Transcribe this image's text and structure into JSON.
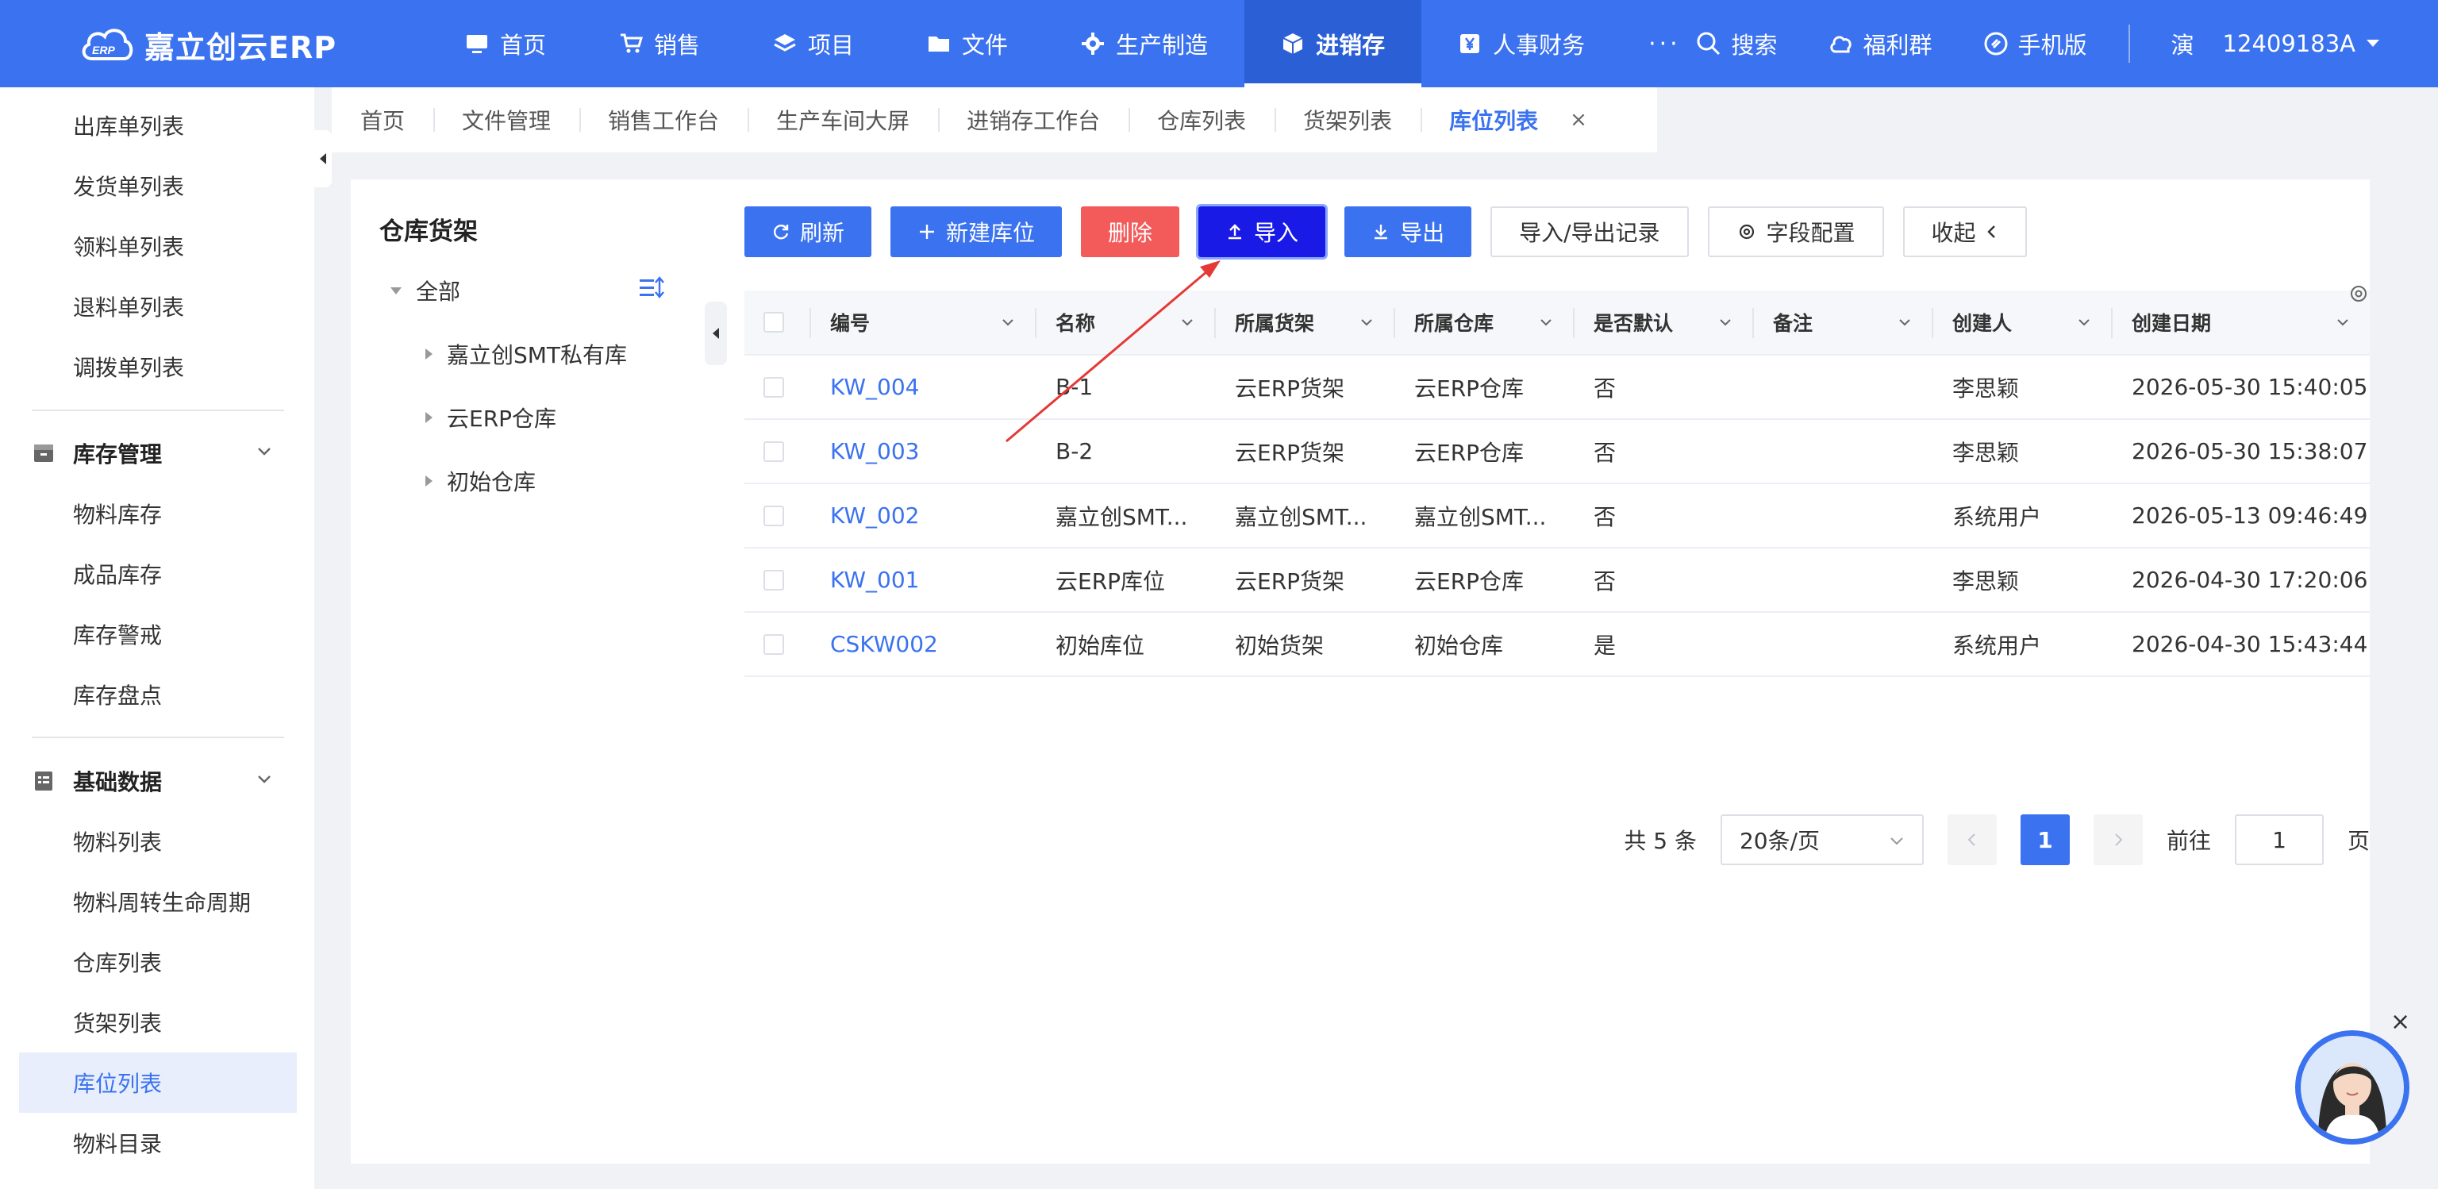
{
  "app": {
    "logo_text": "嘉立创云ERP",
    "logo_badge": "ERP",
    "accent_color": "#3a72f0"
  },
  "nav": {
    "items": [
      {
        "label": "首页",
        "icon": "monitor-icon"
      },
      {
        "label": "销售",
        "icon": "cart-icon"
      },
      {
        "label": "项目",
        "icon": "layers-icon"
      },
      {
        "label": "文件",
        "icon": "folder-icon"
      },
      {
        "label": "生产制造",
        "icon": "gear-icon"
      },
      {
        "label": "进销存",
        "icon": "box-icon",
        "active": true
      },
      {
        "label": "人事财务",
        "icon": "yen-icon"
      }
    ],
    "more": "···"
  },
  "top_right": {
    "search": "搜索",
    "welfare": "福利群",
    "mobile": "手机版",
    "user_initial": "演",
    "user_id": "12409183A"
  },
  "sidebar": {
    "items_top": [
      "出库单列表",
      "发货单列表",
      "领料单列表",
      "退料单列表",
      "调拨单列表"
    ],
    "group_inventory": {
      "label": "库存管理",
      "items": [
        "物料库存",
        "成品库存",
        "库存警戒",
        "库存盘点"
      ]
    },
    "group_basic": {
      "label": "基础数据",
      "items": [
        "物料列表",
        "物料周转生命周期",
        "仓库列表",
        "货架列表",
        "库位列表",
        "物料目录"
      ]
    },
    "active_item": "库位列表"
  },
  "tabs": {
    "items": [
      "首页",
      "文件管理",
      "销售工作台",
      "生产车间大屏",
      "进销存工作台",
      "仓库列表",
      "货架列表",
      "库位列表"
    ],
    "active": "库位列表",
    "close": "×"
  },
  "tree": {
    "title": "仓库货架",
    "root": "全部",
    "nodes": [
      "嘉立创SMT私有库",
      "云ERP仓库",
      "初始仓库"
    ]
  },
  "toolbar": {
    "refresh": "刷新",
    "new": "新建库位",
    "delete": "删除",
    "import": "导入",
    "export": "导出",
    "records": "导入/导出记录",
    "fields": "字段配置",
    "collapse": "收起"
  },
  "table": {
    "columns": [
      "编号",
      "名称",
      "所属货架",
      "所属仓库",
      "是否默认",
      "备注",
      "创建人",
      "创建日期"
    ],
    "rows": [
      {
        "code": "KW_004",
        "name": "B-1",
        "shelf": "云ERP货架",
        "warehouse": "云ERP仓库",
        "default": "否",
        "note": "",
        "creator": "李思颖",
        "date": "2026-05-30 15:40:05"
      },
      {
        "code": "KW_003",
        "name": "B-2",
        "shelf": "云ERP货架",
        "warehouse": "云ERP仓库",
        "default": "否",
        "note": "",
        "creator": "李思颖",
        "date": "2026-05-30 15:38:07"
      },
      {
        "code": "KW_002",
        "name": "嘉立创SMT...",
        "shelf": "嘉立创SMT...",
        "warehouse": "嘉立创SMT...",
        "default": "否",
        "note": "",
        "creator": "系统用户",
        "date": "2026-05-13 09:46:49"
      },
      {
        "code": "KW_001",
        "name": "云ERP库位",
        "shelf": "云ERP货架",
        "warehouse": "云ERP仓库",
        "default": "否",
        "note": "",
        "creator": "李思颖",
        "date": "2026-04-30 17:20:06"
      },
      {
        "code": "CSKW002",
        "name": "初始库位",
        "shelf": "初始货架",
        "warehouse": "初始仓库",
        "default": "是",
        "note": "",
        "creator": "系统用户",
        "date": "2026-04-30 15:43:44"
      }
    ]
  },
  "pager": {
    "total": "共 5 条",
    "page_size": "20条/页",
    "current": "1",
    "goto_label": "前往",
    "goto_value": "1",
    "page_unit": "页"
  },
  "assistant": {
    "close": "×"
  }
}
